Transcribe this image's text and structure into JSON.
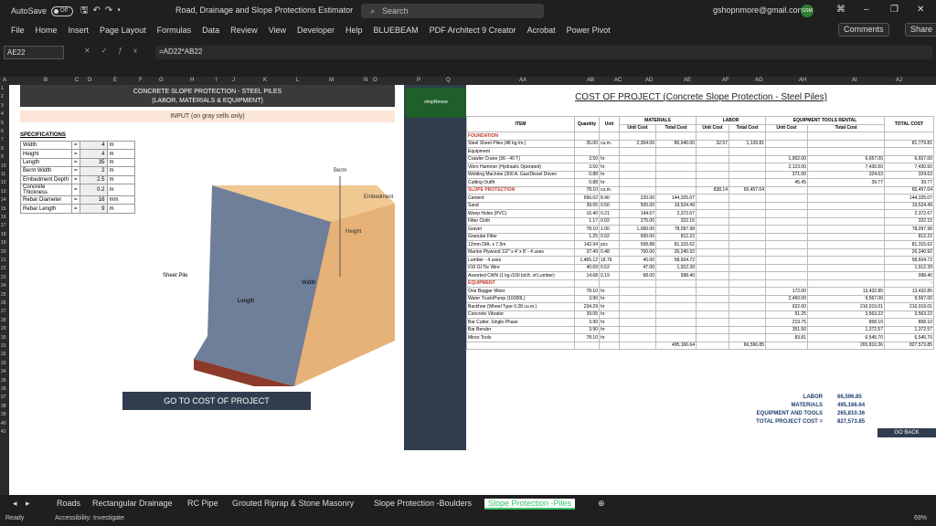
{
  "title_bar": {
    "autosave_label": "AutoSave",
    "autosave_state": "Off",
    "doc_title": "Road, Drainage and Slope Protections Estimator",
    "search_placeholder": "Search",
    "user_email": "gshopnmore@gmail.com",
    "avatar_text": "GSM"
  },
  "menu": {
    "items": [
      "File",
      "Home",
      "Insert",
      "Page Layout",
      "Formulas",
      "Data",
      "Review",
      "View",
      "Developer",
      "Help",
      "BLUEBEAM",
      "PDF Architect 9 Creator",
      "Acrobat",
      "Power Pivot"
    ],
    "comments": "Comments",
    "share": "Share"
  },
  "formula_bar": {
    "cell": "AE22",
    "formula": "=AD22*AB22"
  },
  "columns": [
    "A",
    "B",
    "C",
    "D",
    "E",
    "F",
    "G",
    "H",
    "I",
    "J",
    "K",
    "L",
    "M",
    "N",
    "O",
    "P",
    "Q",
    "AA",
    "AB",
    "AC",
    "AD",
    "AE",
    "AF",
    "AG",
    "AH",
    "AI",
    "AJ"
  ],
  "rows": [
    "1",
    "2",
    "3",
    "4",
    "5",
    "6",
    "7",
    "8",
    "9",
    "10",
    "11",
    "12",
    "13",
    "14",
    "15",
    "16",
    "17",
    "18",
    "19",
    "20",
    "21",
    "22",
    "23",
    "24",
    "25",
    "26",
    "27",
    "28",
    "29",
    "30",
    "31",
    "32",
    "33",
    "34",
    "35",
    "36",
    "37",
    "38",
    "39",
    "40",
    "41"
  ],
  "left": {
    "title1": "CONCRETE SLOPE PROTECTION - STEEL PILES",
    "title2": "(LABOR, MATERIALS & EQUIPMENT)",
    "input_note": "INPUT (on gray cells only)",
    "spec_header": "SPECIFICATIONS",
    "specs": [
      {
        "name": "Width",
        "val": "4",
        "unit": "m"
      },
      {
        "name": "Height",
        "val": "4",
        "unit": "m"
      },
      {
        "name": "Length",
        "val": "35",
        "unit": "m"
      },
      {
        "name": "Berm Width",
        "val": "2",
        "unit": "m"
      },
      {
        "name": "Embedment Depth",
        "val": "2.5",
        "unit": "m"
      },
      {
        "name": "Concrete Thickness",
        "val": "0.2",
        "unit": "m"
      },
      {
        "name": "Rebar Diameter",
        "val": "16",
        "unit": "mm"
      },
      {
        "name": "Rebar Length",
        "val": "9",
        "unit": "m"
      }
    ],
    "diagram_labels": {
      "berm": "Berm",
      "embedment": "Embedment",
      "height": "Height",
      "sheet_pile": "Sheet Pile",
      "length": "Length",
      "width": "Width"
    },
    "go_button": "GO TO COST OF PROJECT"
  },
  "right": {
    "logo": "shopNmore",
    "title": "COST OF PROJECT (Concrete Slope Protection - Steel Piles)",
    "headers": {
      "item": "ITEM",
      "qty": "Quantity",
      "unit": "Unit",
      "materials": "MATERIALS",
      "labor": "LABOR",
      "equip": "EQUIPMENT TOOLS RENTAL",
      "total": "TOTAL COST",
      "unit_cost": "Unit Cost",
      "total_cost": "Total Cost"
    },
    "rows": [
      {
        "item": "FOUNDATION",
        "sec": true,
        "qty": "",
        "unit": "",
        "mu": "",
        "mt": "",
        "lu": "",
        "lt": "",
        "eu": "",
        "et": "",
        "tc": ""
      },
      {
        "item": "Steel Sheet Piles (48 kg./m.)",
        "qty": "35.00",
        "unit": "cu.m.",
        "mu": "2,304.00",
        "mt": "80,640.00",
        "lu": "32.57",
        "lt": "1,139.81",
        "eu": "",
        "et": "",
        "tc": "81,779.81"
      },
      {
        "item": "Equipment",
        "qty": "",
        "unit": "",
        "mu": "",
        "mt": "",
        "lu": "",
        "lt": "",
        "eu": "",
        "et": "",
        "tc": ""
      },
      {
        "item": "Crawler Crane (36 - 40 T)",
        "qty": "3.50",
        "unit": "hr",
        "mu": "",
        "mt": "",
        "lu": "",
        "lt": "",
        "eu": "1,902.00",
        "et": "6,657.00",
        "tc": "6,657.00"
      },
      {
        "item": "Vibro Hammer (Hydraulic Operated)",
        "qty": "3.50",
        "unit": "hr",
        "mu": "",
        "mt": "",
        "lu": "",
        "lt": "",
        "eu": "2,123.00",
        "et": "7,430.50",
        "tc": "7,430.50"
      },
      {
        "item": "Welding Machine (300 A, Gas/Diesel Driven",
        "qty": "0.88",
        "unit": "hr",
        "mu": "",
        "mt": "",
        "lu": "",
        "lt": "",
        "eu": "371.00",
        "et": "324.63",
        "tc": "324.63"
      },
      {
        "item": "Cutting Outfit",
        "qty": "0.88",
        "unit": "hr",
        "mu": "",
        "mt": "",
        "lu": "",
        "lt": "",
        "eu": "45.45",
        "et": "39.77",
        "tc": "39.77"
      },
      {
        "item": "SLOPE PROTECTION",
        "sec": true,
        "qty": "78.10",
        "unit": "cu.m.",
        "mu": "",
        "mt": "",
        "lu": "838.14",
        "lt": "65,457.04",
        "eu": "",
        "et": "",
        "tc": "65,457.04"
      },
      {
        "item": "Cement",
        "qty": "656.02",
        "unit": "8.40",
        "mu": "220.00",
        "mt": "144,325.07",
        "lu": "",
        "lt": "",
        "eu": "",
        "et": "",
        "tc": "144,325.07"
      },
      {
        "item": "Sand",
        "qty": "39.05",
        "unit": "0.50",
        "mu": "500.00",
        "mt": "19,524.49",
        "lu": "",
        "lt": "",
        "eu": "",
        "et": "",
        "tc": "19,524.49"
      },
      {
        "item": "Weep Holes (PVC)",
        "qty": "16.40",
        "unit": "0.21",
        "mu": "144.67",
        "mt": "2,372.67",
        "lu": "",
        "lt": "",
        "eu": "",
        "et": "",
        "tc": "2,372.67"
      },
      {
        "item": "Filter Cloth",
        "qty": "1.17",
        "unit": "0.02",
        "mu": "275.00",
        "mt": "322.15",
        "lu": "",
        "lt": "",
        "eu": "",
        "et": "",
        "tc": "322.15"
      },
      {
        "item": "Gravel",
        "qty": "78.10",
        "unit": "1.00",
        "mu": "1,000.00",
        "mt": "78,097.98",
        "lu": "",
        "lt": "",
        "eu": "",
        "et": "",
        "tc": "78,097.98"
      },
      {
        "item": "Granular Filter",
        "qty": "1.25",
        "unit": "0.02",
        "mu": "650.00",
        "mt": "812.22",
        "lu": "",
        "lt": "",
        "eu": "",
        "et": "",
        "tc": "812.22"
      },
      {
        "item": "12mm DIA. x 7.5m",
        "qty": "142.94",
        "unit": "pcs",
        "mu": "568.88",
        "mt": "81,315.62",
        "lu": "",
        "lt": "",
        "eu": "",
        "et": "",
        "tc": "81,315.62"
      },
      {
        "item": "Marine Plywood 1/2\" x 4' x 8' - 4 uses",
        "qty": "37.49",
        "unit": "0.48",
        "mu": "700.00",
        "mt": "26,240.92",
        "lu": "",
        "lt": "",
        "eu": "",
        "et": "",
        "tc": "26,240.92"
      },
      {
        "item": "Lumber - 4 uses",
        "qty": "1,465.12",
        "unit": "18.76",
        "mu": "40.00",
        "mt": "58,604.72",
        "lu": "",
        "lt": "",
        "eu": "",
        "et": "",
        "tc": "58,604.72"
      },
      {
        "item": "#16 GI Tie Wire",
        "qty": "40.69",
        "unit": "0.52",
        "mu": "47.00",
        "mt": "1,912.39",
        "lu": "",
        "lt": "",
        "eu": "",
        "et": "",
        "tc": "1,912.39"
      },
      {
        "item": "Assorted CWN (1 kg./100 bd.ft. of Lumber)",
        "qty": "14.68",
        "unit": "0.19",
        "mu": "68.00",
        "mt": "998.40",
        "lu": "",
        "lt": "",
        "eu": "",
        "et": "",
        "tc": "998.40"
      },
      {
        "item": "EQUIPMENT",
        "sec": true,
        "qty": "",
        "unit": "",
        "mu": "",
        "mt": "",
        "lu": "",
        "lt": "",
        "eu": "",
        "et": "",
        "tc": "-"
      },
      {
        "item": "One Bagger Mixer",
        "qty": "78.10",
        "unit": "hr",
        "mu": "",
        "mt": "",
        "lu": "",
        "lt": "",
        "eu": "172.00",
        "et": "13,432.85",
        "tc": "13,432.85"
      },
      {
        "item": "Water Truck/Pump (16000L)",
        "qty": "3.90",
        "unit": "hr",
        "mu": "",
        "mt": "",
        "lu": "",
        "lt": "",
        "eu": "2,450.00",
        "et": "9,567.00",
        "tc": "9,567.00"
      },
      {
        "item": "Backhoe (Wheel Type 0.28 cu.m.)",
        "qty": "234.29",
        "unit": "hr",
        "mu": "",
        "mt": "",
        "lu": "",
        "lt": "",
        "eu": "922.00",
        "et": "216,019.01",
        "tc": "216,019.01"
      },
      {
        "item": "Concrete Vibrator",
        "qty": "39.05",
        "unit": "hr",
        "mu": "",
        "mt": "",
        "lu": "",
        "lt": "",
        "eu": "91.25",
        "et": "3,563.22",
        "tc": "3,563.22"
      },
      {
        "item": "Bar Cutter, Single Phase",
        "qty": "3.90",
        "unit": "hr",
        "mu": "",
        "mt": "",
        "lu": "",
        "lt": "",
        "eu": "219.75",
        "et": "858.10",
        "tc": "858.10"
      },
      {
        "item": "Bar Bender",
        "qty": "3.90",
        "unit": "hr",
        "mu": "",
        "mt": "",
        "lu": "",
        "lt": "",
        "eu": "351.50",
        "et": "1,372.57",
        "tc": "1,372.57"
      },
      {
        "item": "Minor Tools",
        "qty": "78.10",
        "unit": "hr",
        "mu": "",
        "mt": "",
        "lu": "",
        "lt": "",
        "eu": "83.81",
        "et": "6,545.70",
        "tc": "6,545.70"
      },
      {
        "item": "",
        "qty": "",
        "unit": "",
        "mu": "",
        "mt": "495,166.64",
        "lu": "",
        "lt": "66,596.85",
        "eu": "",
        "et": "265,810.36",
        "tc": "827,573.85"
      }
    ],
    "summary": [
      {
        "label": "LABOR",
        "val": "66,596.85"
      },
      {
        "label": "MATERIALS",
        "val": "495,166.64"
      },
      {
        "label": "EQUIPMENT AND TOOLS",
        "val": "265,810.36"
      },
      {
        "label": "TOTAL PROJECT COST =",
        "val": "827,573.85"
      }
    ],
    "go_back": "GO BACK"
  },
  "tabs": [
    "Roads",
    "Rectangular Drainage",
    "RC Pipe",
    "Grouted Riprap & Stone Masonry",
    "Slope Protection -Boulders",
    "Slope Protection -Piles"
  ],
  "status": {
    "ready": "Ready",
    "accessibility": "Accessibility: Investigate",
    "zoom": "69%"
  }
}
